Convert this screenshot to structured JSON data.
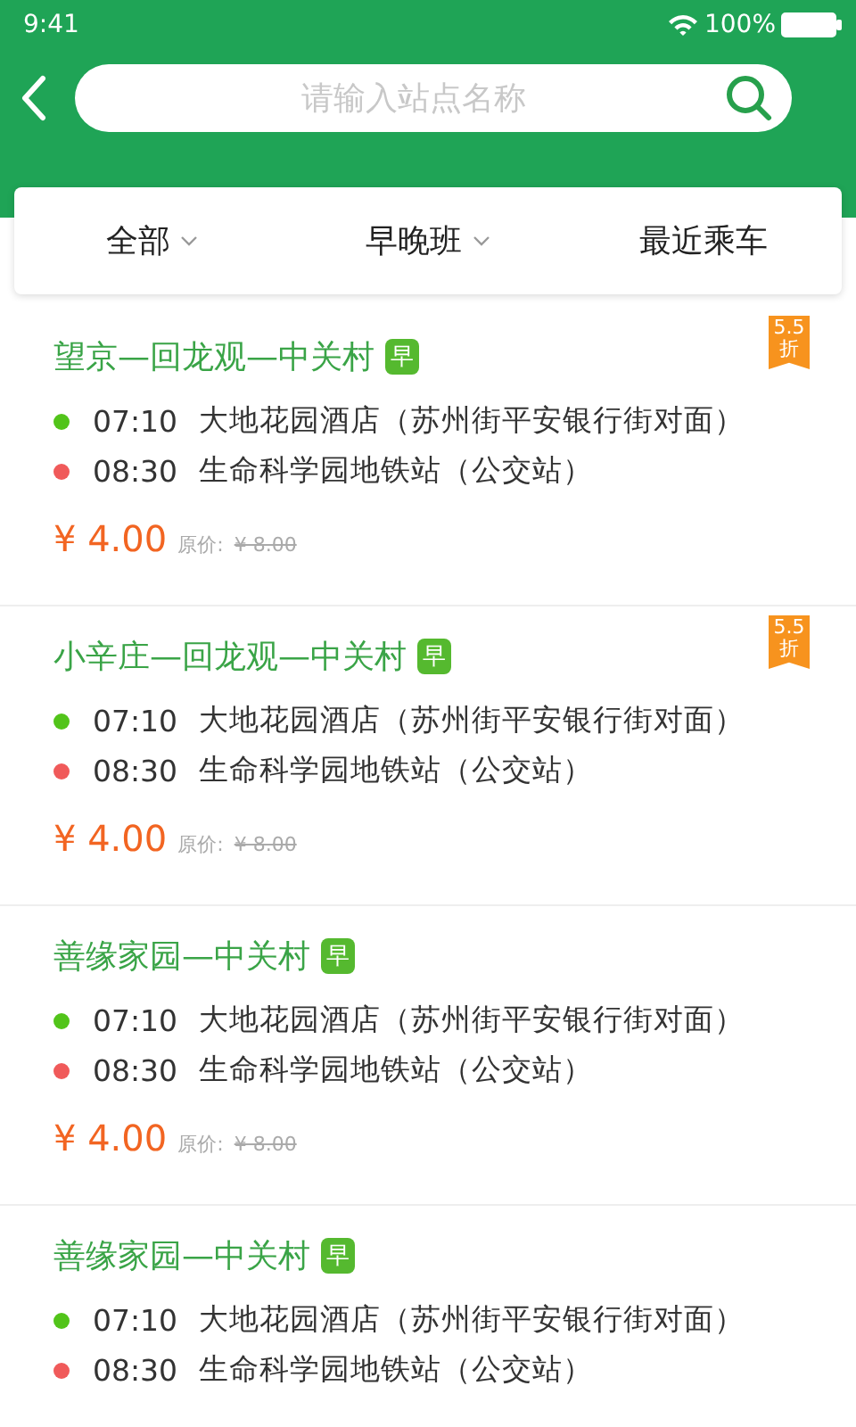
{
  "status_bar": {
    "time": "9:41",
    "battery": "100%"
  },
  "search": {
    "placeholder": "请输入站点名称"
  },
  "filters": [
    {
      "label": "全部",
      "dropdown": true
    },
    {
      "label": "早晚班",
      "dropdown": true
    },
    {
      "label": "最近乘车",
      "dropdown": false
    }
  ],
  "routes": [
    {
      "title": "望京—回龙观—中关村",
      "tag": "早",
      "discount": [
        "5.5",
        "折"
      ],
      "stops": [
        {
          "time": "07:10",
          "name": "大地花园酒店（苏州街平安银行街对面）",
          "color": "#52c41a"
        },
        {
          "time": "08:30",
          "name": "生命科学园地铁站（公交站）",
          "color": "#f05a5a"
        }
      ],
      "price": "¥ 4.00",
      "original_label": "原价:",
      "original_price": "¥ 8.00"
    },
    {
      "title": "小辛庄—回龙观—中关村",
      "tag": "早",
      "discount": [
        "5.5",
        "折"
      ],
      "stops": [
        {
          "time": "07:10",
          "name": "大地花园酒店（苏州街平安银行街对面）",
          "color": "#52c41a"
        },
        {
          "time": "08:30",
          "name": "生命科学园地铁站（公交站）",
          "color": "#f05a5a"
        }
      ],
      "price": "¥ 4.00",
      "original_label": "原价:",
      "original_price": "¥ 8.00"
    },
    {
      "title": "善缘家园—中关村",
      "tag": "早",
      "stops": [
        {
          "time": "07:10",
          "name": "大地花园酒店（苏州街平安银行街对面）",
          "color": "#52c41a"
        },
        {
          "time": "08:30",
          "name": "生命科学园地铁站（公交站）",
          "color": "#f05a5a"
        }
      ],
      "price": "¥ 4.00",
      "original_label": "原价:",
      "original_price": "¥ 8.00"
    },
    {
      "title": "善缘家园—中关村",
      "tag": "早",
      "stops": [
        {
          "time": "07:10",
          "name": "大地花园酒店（苏州街平安银行街对面）",
          "color": "#52c41a"
        },
        {
          "time": "08:30",
          "name": "生命科学园地铁站（公交站）",
          "color": "#f05a5a"
        }
      ]
    }
  ]
}
